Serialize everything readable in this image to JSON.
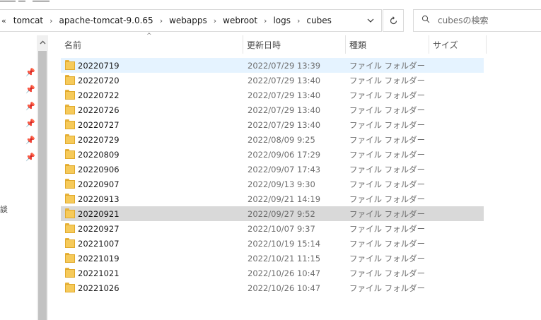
{
  "address": {
    "lead": "«",
    "crumbs": [
      "tomcat",
      "apache-tomcat-9.0.65",
      "webapps",
      "webroot",
      "logs",
      "cubes"
    ],
    "separator": "›",
    "dropdown_icon": "chevron-down-icon",
    "refresh_icon": "refresh-icon"
  },
  "search": {
    "placeholder": "cubesの検索",
    "icon": "search-icon"
  },
  "nav": {
    "pin_icon": "pin-icon",
    "pin_count": 6,
    "cut_text": "談"
  },
  "columns": {
    "name": "名前",
    "modified": "更新日時",
    "type": "種類",
    "size": "サイズ",
    "sort_indicator": "^"
  },
  "files": [
    {
      "name": "20220719",
      "modified": "2022/07/29 13:39",
      "type": "ファイル フォルダー"
    },
    {
      "name": "20220720",
      "modified": "2022/07/29 13:40",
      "type": "ファイル フォルダー"
    },
    {
      "name": "20220722",
      "modified": "2022/07/29 13:40",
      "type": "ファイル フォルダー"
    },
    {
      "name": "20220726",
      "modified": "2022/07/29 13:40",
      "type": "ファイル フォルダー"
    },
    {
      "name": "20220727",
      "modified": "2022/07/29 13:40",
      "type": "ファイル フォルダー"
    },
    {
      "name": "20220729",
      "modified": "2022/08/09 9:25",
      "type": "ファイル フォルダー"
    },
    {
      "name": "20220809",
      "modified": "2022/09/06 17:29",
      "type": "ファイル フォルダー"
    },
    {
      "name": "20220906",
      "modified": "2022/09/07 17:43",
      "type": "ファイル フォルダー"
    },
    {
      "name": "20220907",
      "modified": "2022/09/13 9:30",
      "type": "ファイル フォルダー"
    },
    {
      "name": "20220913",
      "modified": "2022/09/21 14:19",
      "type": "ファイル フォルダー"
    },
    {
      "name": "20220921",
      "modified": "2022/09/27 9:52",
      "type": "ファイル フォルダー"
    },
    {
      "name": "20220927",
      "modified": "2022/10/07 9:37",
      "type": "ファイル フォルダー"
    },
    {
      "name": "20221007",
      "modified": "2022/10/19 15:14",
      "type": "ファイル フォルダー"
    },
    {
      "name": "20221019",
      "modified": "2022/10/21 11:15",
      "type": "ファイル フォルダー"
    },
    {
      "name": "20221021",
      "modified": "2022/10/26 10:47",
      "type": "ファイル フォルダー"
    },
    {
      "name": "20221026",
      "modified": "2022/10/26 10:47",
      "type": "ファイル フォルダー"
    }
  ],
  "row_states": {
    "hover_index": 0,
    "selected_index": 10
  },
  "colors": {
    "hover_bg": "#e5f3ff",
    "selected_bg": "#d9d9d9",
    "folder": "#f6ca5a"
  }
}
